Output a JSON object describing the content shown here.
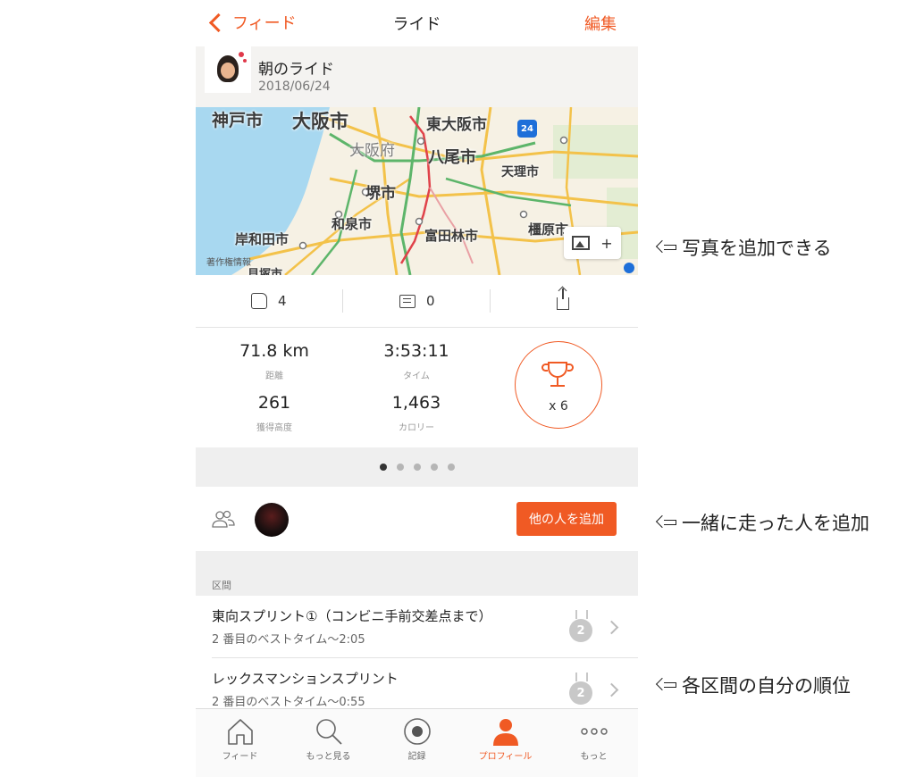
{
  "nav": {
    "back_label": "フィード",
    "title": "ライド",
    "edit_label": "編集"
  },
  "ride": {
    "name": "朝のライド",
    "date": "2018/06/24"
  },
  "map": {
    "labels": {
      "kobe": "神戸市",
      "osaka_city": "大阪市",
      "higashiosaka": "東大阪市",
      "osaka_pref": "大阪府",
      "yao": "八尾市",
      "tenri": "天理市",
      "sakai": "堺市",
      "izumi": "和泉市",
      "tondabayashi": "富田林市",
      "kashihara": "橿原市",
      "kishiwada": "岸和田市",
      "kaizuka": "貝塚市"
    },
    "route_number": "24",
    "copyright": "著作権情報",
    "add_photo_plus": "+"
  },
  "actions": {
    "likes": "4",
    "comments": "0"
  },
  "stats": {
    "distance": {
      "value": "71.8 km",
      "label": "距離"
    },
    "time": {
      "value": "3:53:11",
      "label": "タイム"
    },
    "elevation": {
      "value": "261",
      "label": "獲得高度"
    },
    "calories": {
      "value": "1,463",
      "label": "カロリー"
    },
    "trophies": "x 6"
  },
  "pager": {
    "count": 5,
    "active": 0
  },
  "companions": {
    "add_button": "他の人を追加"
  },
  "segments": {
    "header": "区間",
    "items": [
      {
        "title": "東向スプリント①（コンビニ手前交差点まで）",
        "subtitle": "2 番目のベストタイム〜2:05",
        "rank": "2"
      },
      {
        "title": "レックスマンションスプリント",
        "subtitle": "2 番目のベストタイム〜0:55",
        "rank": "2"
      }
    ]
  },
  "tabbar": {
    "items": [
      {
        "label": "フィード",
        "icon": "home-icon"
      },
      {
        "label": "もっと見る",
        "icon": "search-icon"
      },
      {
        "label": "記録",
        "icon": "record-icon"
      },
      {
        "label": "プロフィール",
        "icon": "profile-icon"
      },
      {
        "label": "もっと",
        "icon": "more-icon"
      }
    ],
    "active": 3
  },
  "annotations": {
    "photo": "写真を追加できる",
    "companions": "一緒に走った人を追加",
    "segments": "各区間の自分の順位"
  },
  "colors": {
    "accent": "#f05a24",
    "medal_silver": "#c8c8c8",
    "route_blue": "#1e6fd9"
  }
}
